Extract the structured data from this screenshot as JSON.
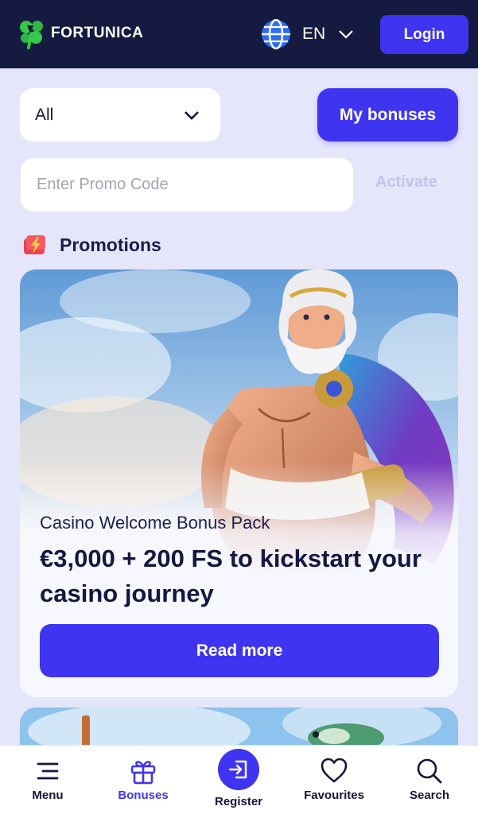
{
  "header": {
    "logo_text": "FORTUNICA",
    "language": "EN",
    "login_label": "Login"
  },
  "controls": {
    "filter_value": "All",
    "my_bonuses_label": "My bonuses",
    "promo_placeholder": "Enter Promo Code",
    "activate_label": "Activate"
  },
  "section": {
    "title": "Promotions",
    "icon": "lightning-gift-icon"
  },
  "promo_card": {
    "subtitle": "Casino Welcome Bonus Pack",
    "title": "€3,000 + 200 FS to kickstart your casino journey",
    "button_label": "Read more",
    "image": "zeus-character-art"
  },
  "bottom_nav": {
    "items": [
      {
        "label": "Menu",
        "icon": "menu-icon"
      },
      {
        "label": "Bonuses",
        "icon": "gift-icon",
        "active": true
      },
      {
        "label": "Register",
        "icon": "register-icon"
      },
      {
        "label": "Favourites",
        "icon": "heart-icon"
      },
      {
        "label": "Search",
        "icon": "search-icon"
      }
    ]
  },
  "colors": {
    "header_bg": "#141a40",
    "accent": "#3f35f0",
    "page_bg": "#e6e6fb",
    "logo_green": "#37c94b"
  }
}
